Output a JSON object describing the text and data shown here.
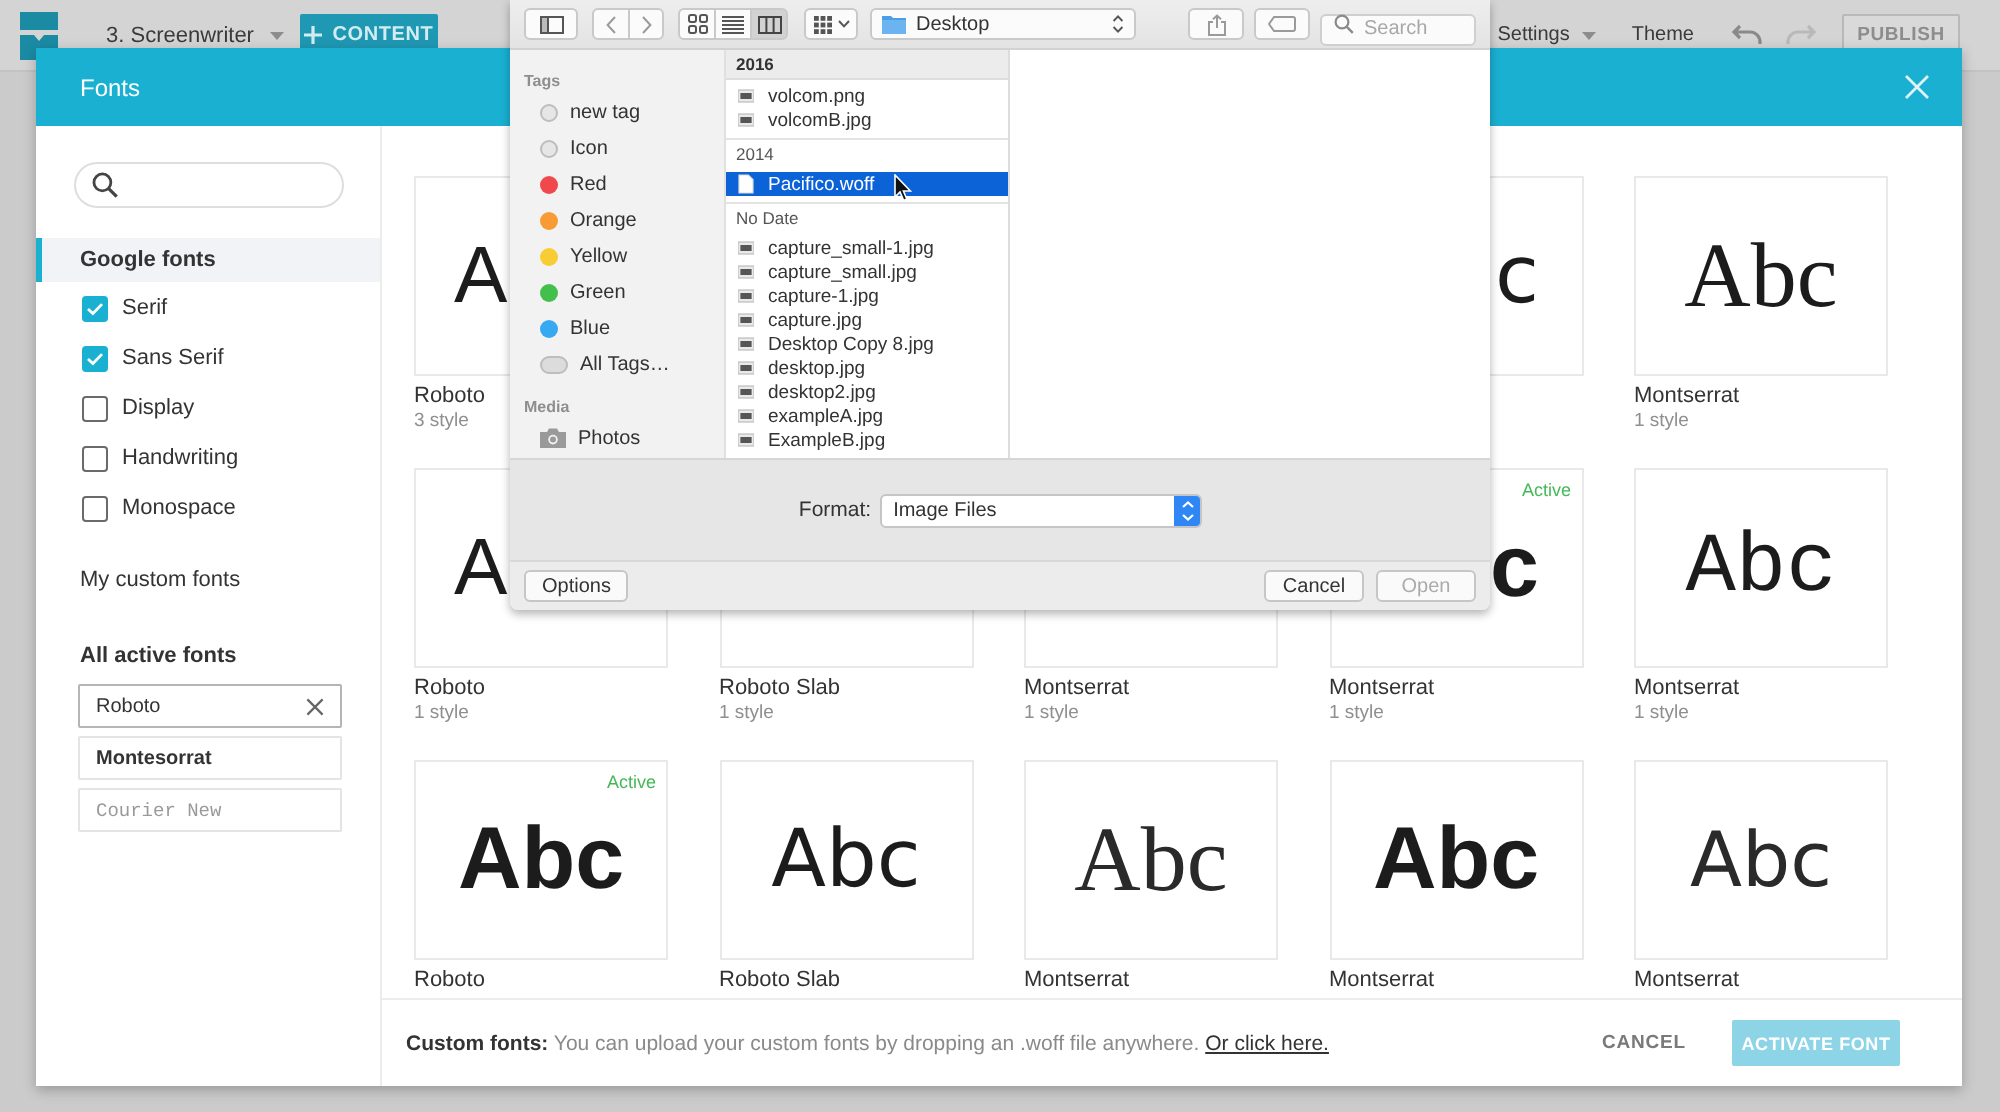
{
  "app_bar": {
    "project": "3. Screenwriter",
    "add_button": "CONTENT",
    "menus": [
      {
        "label": "Settings",
        "kind": "dropdown"
      },
      {
        "label": "Theme",
        "kind": "plain"
      }
    ],
    "history": [
      {
        "kind": "undo",
        "disabled": false
      },
      {
        "kind": "redo",
        "disabled": true
      }
    ],
    "publish": "PUBLISH"
  },
  "file_dialog": {
    "view_modes": [
      {
        "kind": "icons",
        "selected": false
      },
      {
        "kind": "list",
        "selected": false
      },
      {
        "kind": "columns",
        "selected": true
      }
    ],
    "location": "Desktop",
    "search": {
      "placeholder": "Search"
    },
    "sidebar": [
      {
        "title": "Tags",
        "items": [
          {
            "label": "new tag",
            "kind": "empty"
          },
          {
            "label": "Icon",
            "kind": "empty"
          },
          {
            "label": "Red",
            "kind": "color",
            "color": "#f0494b"
          },
          {
            "label": "Orange",
            "kind": "color",
            "color": "#f89b35"
          },
          {
            "label": "Yellow",
            "kind": "color",
            "color": "#f7cd33"
          },
          {
            "label": "Green",
            "kind": "color",
            "color": "#43c04c"
          },
          {
            "label": "Blue",
            "kind": "color",
            "color": "#36a9f2"
          },
          {
            "label": "All Tags…",
            "kind": "all"
          }
        ]
      },
      {
        "title": "Media",
        "items": [
          {
            "label": "Photos",
            "kind": "photos"
          }
        ]
      }
    ],
    "groups": [
      {
        "label": "2016",
        "files": [
          {
            "name": "volcom.png",
            "kind": "image",
            "selected": false
          },
          {
            "name": "volcomB.jpg",
            "kind": "image",
            "selected": false
          }
        ]
      },
      {
        "label": "2014",
        "files": [
          {
            "name": "Pacifico.woff",
            "kind": "document",
            "selected": true
          }
        ]
      },
      {
        "label": "No Date",
        "files": [
          {
            "name": "capture_small-1.jpg",
            "kind": "image",
            "selected": false
          },
          {
            "name": "capture_small.jpg",
            "kind": "image",
            "selected": false
          },
          {
            "name": "capture-1.jpg",
            "kind": "image",
            "selected": false
          },
          {
            "name": "capture.jpg",
            "kind": "image",
            "selected": false
          },
          {
            "name": "Desktop Copy 8.jpg",
            "kind": "image",
            "selected": false
          },
          {
            "name": "desktop.jpg",
            "kind": "image",
            "selected": false
          },
          {
            "name": "desktop2.jpg",
            "kind": "image",
            "selected": false
          },
          {
            "name": "exampleA.jpg",
            "kind": "image",
            "selected": false
          },
          {
            "name": "ExampleB.jpg",
            "kind": "image",
            "selected": false
          }
        ]
      }
    ],
    "format": {
      "label": "Format:",
      "value": "Image Files"
    },
    "buttons": [
      {
        "label": "Options",
        "kind": "options",
        "disabled": false
      },
      {
        "label": "Cancel",
        "kind": "cancel",
        "disabled": false
      },
      {
        "label": "Open",
        "kind": "open",
        "disabled": true
      }
    ]
  },
  "modal": {
    "title": "Fonts"
  },
  "sidebar": {
    "sections": [
      {
        "label": "Google fonts",
        "selected": true,
        "filters": [
          {
            "label": "Serif",
            "checked": true
          },
          {
            "label": "Sans Serif",
            "checked": true
          },
          {
            "label": "Display",
            "checked": false
          },
          {
            "label": "Handwriting",
            "checked": false
          },
          {
            "label": "Monospace",
            "checked": false
          }
        ]
      },
      {
        "label": "My custom fonts",
        "selected": false
      }
    ],
    "active_fonts": {
      "title": "All active fonts",
      "items": [
        {
          "label": "Roboto",
          "kind": "removable"
        },
        {
          "label": "Montesorrat",
          "kind": "bold"
        },
        {
          "label": "Courier New",
          "kind": "mono"
        }
      ]
    }
  },
  "font_grid": {
    "rows": [
      [
        {
          "sample": "A",
          "covered_right": true,
          "kind": "hand",
          "name": "Roboto",
          "styles": "3 style"
        },
        null,
        null,
        {
          "sample": "c",
          "covered_left": true,
          "kind": "sans"
        },
        {
          "sample": "Abc",
          "kind": "serif",
          "name": "Montserrat",
          "styles": "1 style"
        }
      ],
      [
        {
          "sample": "A",
          "covered_right": true,
          "kind": "hand",
          "name": "Roboto",
          "styles": "1 style"
        },
        {
          "name": "Roboto Slab",
          "styles": "1 style"
        },
        {
          "name": "Montserrat",
          "styles": "1 style"
        },
        {
          "badge": "Active",
          "sample": "c",
          "covered_left": true,
          "kind": "geometric",
          "name": "Montserrat",
          "styles": "1 style"
        },
        {
          "sample": "Abc",
          "kind": "mono",
          "name": "Montserrat",
          "styles": "1 style"
        }
      ],
      [
        {
          "badge": "Active",
          "sample": "Abc",
          "kind": "geometric",
          "name": "Roboto"
        },
        {
          "sample": "Abc",
          "kind": "sans",
          "name": "Roboto Slab"
        },
        {
          "sample": "Abc",
          "kind": "light-serif",
          "name": "Montserrat"
        },
        {
          "sample": "Abc",
          "kind": "geometric",
          "name": "Montserrat"
        },
        {
          "sample": "Abc",
          "kind": "display",
          "name": "Montserrat"
        }
      ]
    ]
  },
  "footer": {
    "note": "**Custom fonts:** You can upload your custom fonts by dropping an .woff file anywhere.",
    "link": "Or click here.",
    "cancel": "CANCEL",
    "activate": {
      "label": "ACTIVATE FONT",
      "disabled": true
    }
  }
}
